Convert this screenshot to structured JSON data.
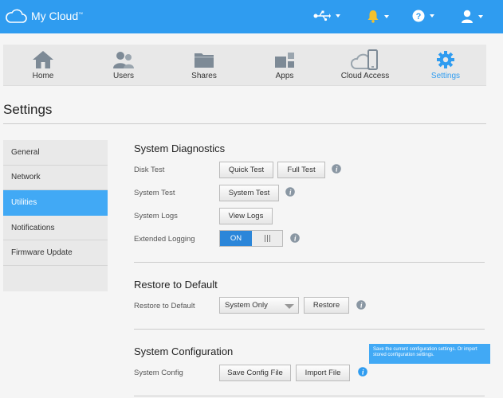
{
  "header": {
    "brand": "My Cloud",
    "trademark": "™"
  },
  "nav": {
    "items": [
      {
        "label": "Home",
        "icon": "home-icon"
      },
      {
        "label": "Users",
        "icon": "users-icon"
      },
      {
        "label": "Shares",
        "icon": "folder-icon"
      },
      {
        "label": "Apps",
        "icon": "apps-icon"
      },
      {
        "label": "Cloud Access",
        "icon": "cloud-device-icon"
      },
      {
        "label": "Settings",
        "icon": "gear-icon"
      }
    ],
    "active": "Settings"
  },
  "page": {
    "title": "Settings"
  },
  "sidebar": {
    "items": [
      {
        "label": "General"
      },
      {
        "label": "Network"
      },
      {
        "label": "Utilities"
      },
      {
        "label": "Notifications"
      },
      {
        "label": "Firmware Update"
      }
    ],
    "active": "Utilities"
  },
  "diagnostics": {
    "title": "System Diagnostics",
    "disk_test_label": "Disk Test",
    "quick_test": "Quick Test",
    "full_test": "Full Test",
    "system_test_label": "System Test",
    "system_test": "System Test",
    "system_logs_label": "System Logs",
    "view_logs": "View Logs",
    "extended_logging_label": "Extended Logging",
    "toggle_on": "ON",
    "extended_logging_state": "ON"
  },
  "restore": {
    "title": "Restore to Default",
    "label": "Restore to Default",
    "selected": "System Only",
    "button": "Restore"
  },
  "config": {
    "title": "System Configuration",
    "label": "System Config",
    "save_button": "Save Config File",
    "import_button": "Import File",
    "tooltip": "Save the current configuration settings. Or import stored configuration settings."
  },
  "colors": {
    "header": "#2f9cf0",
    "accent": "#41a9f5",
    "toggle_on": "#2b86d9"
  }
}
